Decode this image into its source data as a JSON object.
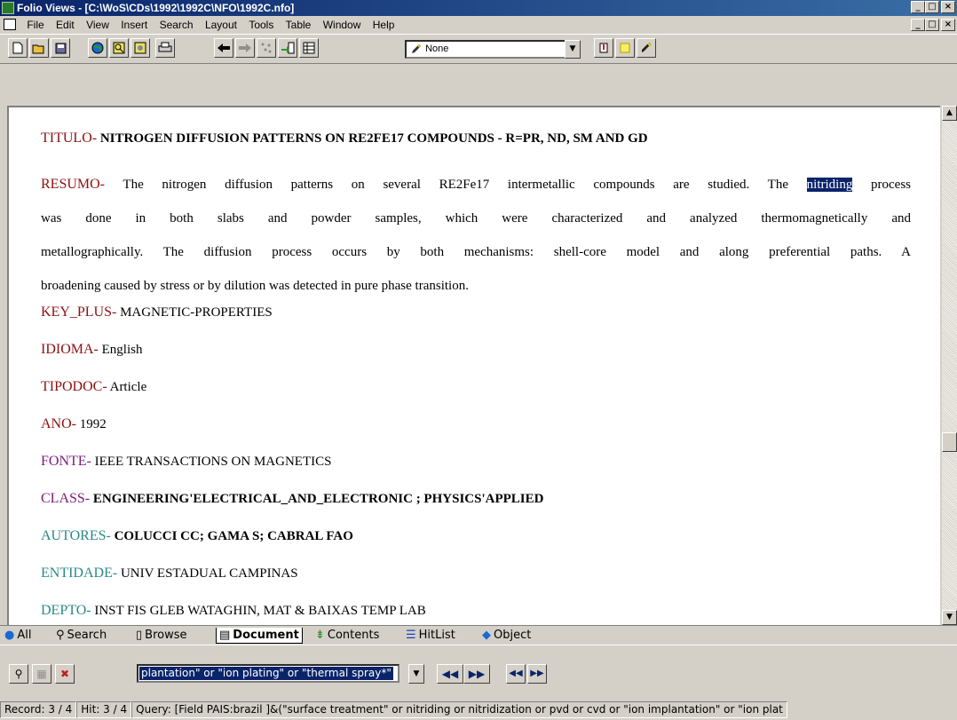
{
  "window": {
    "title": "Folio Views - [C:\\WoS\\CDs\\1992\\1992C\\NFO\\1992C.nfo]",
    "min": "_",
    "max": "□",
    "close": "×"
  },
  "menu": [
    "File",
    "Edit",
    "View",
    "Insert",
    "Search",
    "Layout",
    "Tools",
    "Table",
    "Window",
    "Help"
  ],
  "toolbar": {
    "highlighter_value": "None",
    "icons": [
      "new-icon",
      "open-icon",
      "save-icon",
      "globe-icon",
      "find-icon",
      "query-icon",
      "print-icon",
      "back-icon",
      "forward-icon",
      "scatter-icon",
      "jump-icon",
      "grid-icon",
      "highlighter-icon",
      "dropdown-icon",
      "tag-icon",
      "note-icon",
      "marker-icon"
    ]
  },
  "document": {
    "titulo_label": "TITULO-",
    "titulo_value": "NITROGEN DIFFUSION PATTERNS ON RE2FE17 COMPOUNDS - R=PR, ND, SM AND GD",
    "resumo_label": "RESUMO-",
    "resumo_line1_a": "The nitrogen diffusion patterns on several RE2Fe17 intermetallic compounds are studied. The",
    "resumo_highlight": "nitriding",
    "resumo_line1_b": "process",
    "resumo_line2": "was done in both slabs and powder samples, which were characterized and analyzed thermomagnetically and",
    "resumo_line3": "metallographically. The diffusion process occurs by both mechanisms: shell-core model and along preferential paths. A",
    "resumo_line4": "broadening caused by stress or by dilution was detected in pure phase transition.",
    "keyplus_label": "KEY_PLUS-",
    "keyplus_value": "MAGNETIC-PROPERTIES",
    "idioma_label": "IDIOMA-",
    "idioma_value": "English",
    "tipodoc_label": "TIPODOC-",
    "tipodoc_value": "Article",
    "ano_label": "ANO-",
    "ano_value": "1992",
    "fonte_label": "FONTE-",
    "fonte_value": "IEEE TRANSACTIONS ON MAGNETICS",
    "class_label": "CLASS-",
    "class_value": "ENGINEERING'ELECTRICAL_AND_ELECTRONIC ; PHYSICS'APPLIED",
    "autores_label": "AUTORES-",
    "autores_value": "COLUCCI CC; GAMA S; CABRAL FAO",
    "entidade_label": "ENTIDADE-",
    "entidade_value": "UNIV ESTADUAL CAMPINAS",
    "depto_label": "DEPTO-",
    "depto_value": "INST FIS GLEB WATAGHIN, MAT & BAIXAS TEMP LAB"
  },
  "tabs": {
    "all": "All",
    "search": "Search",
    "browse": "Browse",
    "document": "Document",
    "contents": "Contents",
    "hitlist": "HitList",
    "object": "Object"
  },
  "query": {
    "input_text": "plantation\" or \"ion plating\" or \"thermal spray*\""
  },
  "status": {
    "record": "Record: 3 / 4",
    "hit": "Hit: 3 / 4",
    "query": "Query: [Field PAIS:brazil ]&(\"surface treatment\" or nitriding or nitridization or pvd or cvd or \"ion implantation\" or \"ion plat"
  },
  "colors": {
    "field_red": "#8b1010",
    "field_purple": "#7a1a7a",
    "field_teal": "#2a8a8a",
    "selection": "#0a246a"
  }
}
